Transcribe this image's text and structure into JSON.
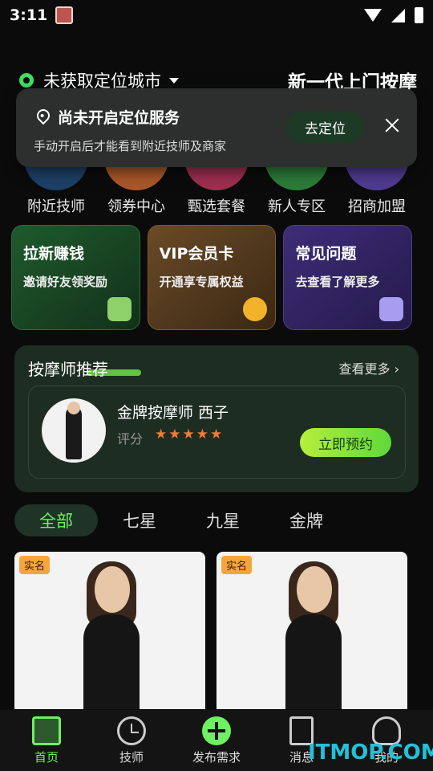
{
  "status": {
    "time": "3:11"
  },
  "header": {
    "city": "未获取定位城市",
    "brand": "新一代上门按摩"
  },
  "popup": {
    "title": "尚未开启定位服务",
    "description": "手动开启后才能看到附近技师及商家",
    "button": "去定位"
  },
  "quick_nav": [
    {
      "label": "附近技师",
      "color": "#3a79a8"
    },
    {
      "label": "领券中心",
      "color": "#e0752c"
    },
    {
      "label": "甄选套餐",
      "color": "#d3486e"
    },
    {
      "label": "新人专区",
      "color": "#33b34a"
    },
    {
      "label": "招商加盟",
      "color": "#7058c8"
    }
  ],
  "promos": [
    {
      "title": "拉新赚钱",
      "subtitle": "邀请好友领奖励"
    },
    {
      "title": "VIP会员卡",
      "subtitle": "开通享专属权益"
    },
    {
      "title": "常见问题",
      "subtitle": "去查看了解更多"
    }
  ],
  "recommend": {
    "title": "按摩师推荐",
    "more": "查看更多 ›",
    "name": "金牌按摩师 西子",
    "score_label": "评分",
    "stars": "★★★★★",
    "button": "立即预约"
  },
  "tabs": [
    "全部",
    "七星",
    "九星",
    "金牌"
  ],
  "cards": [
    {
      "badge": "实名"
    },
    {
      "badge": "实名"
    }
  ],
  "bottom_nav": [
    "首页",
    "技师",
    "发布需求",
    "消息",
    "我的"
  ],
  "watermark": "ITMOP.COM",
  "colors": {
    "accent": "#6ff062",
    "background": "#0b0b0b"
  }
}
